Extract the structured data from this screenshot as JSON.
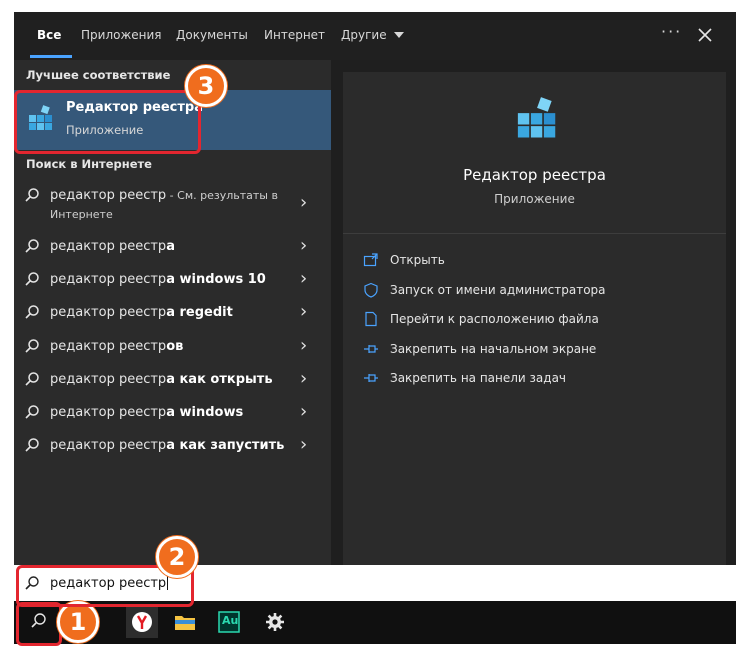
{
  "tabs": [
    {
      "label": "Все",
      "active": true
    },
    {
      "label": "Приложения"
    },
    {
      "label": "Документы"
    },
    {
      "label": "Интернет"
    },
    {
      "label": "Другие"
    }
  ],
  "more_label": "···",
  "best_match": {
    "section_label": "Лучшее соответствие",
    "title": "Редактор реестра",
    "subtitle": "Приложение"
  },
  "web_search": {
    "section_label": "Поиск в Интернете",
    "items": [
      {
        "query": "редактор реестр",
        "suffix": " - См. результаты в",
        "line2": "Интернете"
      },
      {
        "query": "редактор реестр",
        "bold": "а"
      },
      {
        "query": "редактор реестр",
        "bold": "а windows 10"
      },
      {
        "query": "редактор реестр",
        "bold": "а regedit"
      },
      {
        "query": "редактор реестр",
        "bold": "ов"
      },
      {
        "query": "редактор реестр",
        "bold": "а как открыть"
      },
      {
        "query": "редактор реестр",
        "bold": "а windows"
      },
      {
        "query": "редактор реестр",
        "bold": "а как запустить"
      }
    ]
  },
  "preview": {
    "title": "Редактор реестра",
    "subtitle": "Приложение",
    "actions": [
      {
        "label": "Открыть",
        "icon": "open-icon"
      },
      {
        "label": "Запуск от имени администратора",
        "icon": "shield-icon"
      },
      {
        "label": "Перейти к расположению файла",
        "icon": "file-location-icon"
      },
      {
        "label": "Закрепить на начальном экране",
        "icon": "pin-icon"
      },
      {
        "label": "Закрепить на панели задач",
        "icon": "pin-icon"
      }
    ]
  },
  "search": {
    "value": "редактор реестр"
  },
  "callouts": {
    "one": "1",
    "two": "2",
    "three": "3"
  },
  "taskbar": {
    "audition_label": "Au"
  },
  "colors": {
    "accent": "#4aa3ff",
    "selected": "#35587a",
    "callout_border": "#e3262f",
    "badge": "#f06d1e"
  }
}
